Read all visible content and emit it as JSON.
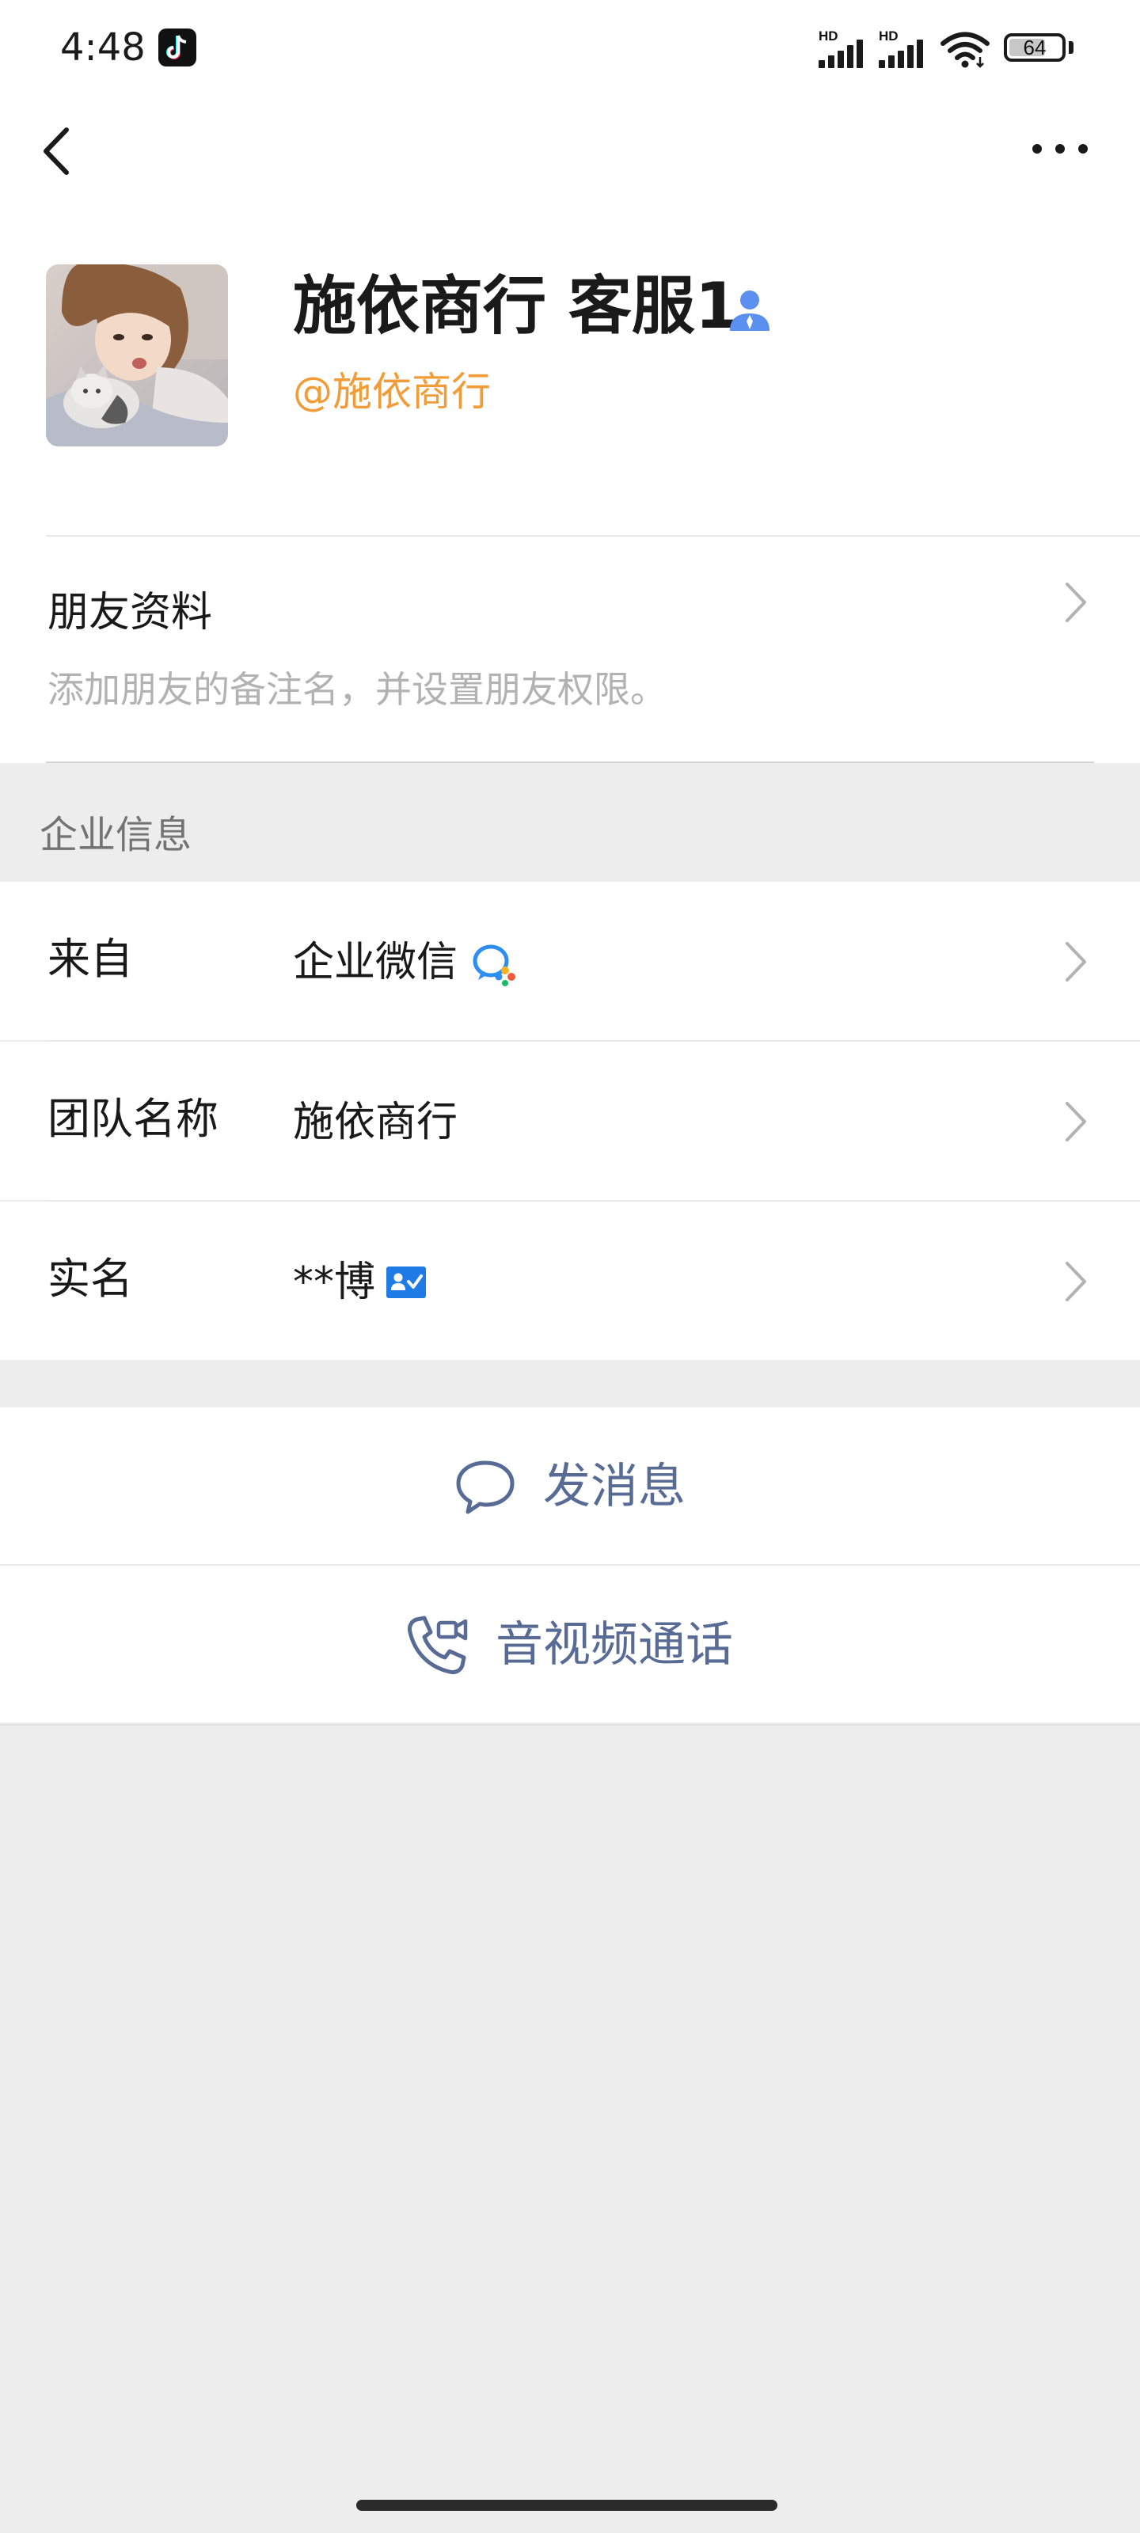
{
  "status_bar": {
    "time": "4:48",
    "signal_1_label": "HD",
    "signal_2_label": "HD",
    "battery_level": "64",
    "icons": [
      "tiktok-icon",
      "signal-icon",
      "wifi-icon",
      "battery-icon"
    ]
  },
  "nav": {
    "back_icon": "chevron-left-icon",
    "more_icon": "more-dots-icon"
  },
  "profile": {
    "name": "施依商行 客服1",
    "handle": "@施依商行",
    "badge_icon": "person-badge-icon",
    "badge_color": "#5b8ff0"
  },
  "friend_info": {
    "title": "朋友资料",
    "description": "添加朋友的备注名，并设置朋友权限。"
  },
  "company_section": {
    "label": "企业信息",
    "rows": [
      {
        "key": "来自",
        "value": "企业微信",
        "icon": "wecom-icon"
      },
      {
        "key": "团队名称",
        "value": "施依商行"
      },
      {
        "key": "实名",
        "value": "**博",
        "icon": "realname-verified-icon"
      }
    ]
  },
  "actions": {
    "message_label": "发消息",
    "message_icon": "chat-bubble-icon",
    "call_label": "音视频通话",
    "call_icon": "video-call-icon",
    "link_color": "#576b95"
  },
  "colors": {
    "background": "#ededed",
    "handle": "#f29c38",
    "verified": "#1f7ce6"
  }
}
